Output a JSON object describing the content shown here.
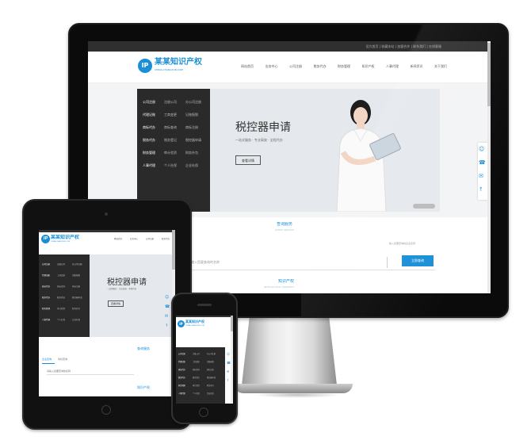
{
  "brand": {
    "name": "某某知识产权",
    "domain": "CHINA-CHANGXUN.COM",
    "logo_mark": "IP"
  },
  "topbar": {
    "links": [
      "设为首页",
      "收藏本站",
      "加盟合作",
      "联系我们",
      "在线客服"
    ]
  },
  "nav": {
    "items": [
      "网站首页",
      "业务中心",
      "公司注册",
      "税务代办",
      "财务管理",
      "知识产权",
      "人事代理",
      "新闻资讯",
      "关于我们"
    ]
  },
  "menu": {
    "rows": [
      [
        "公司注册",
        "注册公司",
        "分公司注册"
      ],
      [
        "代理记账",
        "工商变更",
        "记账报税"
      ],
      [
        "商标代办",
        "商标查询",
        "商标注册"
      ],
      [
        "税务代办",
        "税务登记",
        "税控器申请"
      ],
      [
        "财务管理",
        "审计验资",
        "财务外包"
      ],
      [
        "人事代理",
        "个人社保",
        "企业社保"
      ]
    ]
  },
  "banner": {
    "title": "税控器申请",
    "subtitle": "一站式服务 · 专业高效 · 全程代办",
    "button": "查看详情"
  },
  "query": {
    "title": "查询服务",
    "subtitle": "QUERY SERVICE",
    "note": "输入您要查询的企业名称",
    "input_placeholder": "请输入您要查询的名称",
    "button": "立即查询",
    "tabs": [
      "企业查询",
      "商标查询"
    ]
  },
  "ip_section": {
    "title": "知识产权",
    "subtitle": "INTELLECTUAL PROPERTY"
  },
  "side_icons": [
    "user-icon",
    "phone-icon",
    "chat-icon",
    "top-icon"
  ],
  "colors": {
    "accent": "#1a8fd8",
    "dark_panel": "#2a2a2a",
    "banner": "#e5e9ed"
  }
}
